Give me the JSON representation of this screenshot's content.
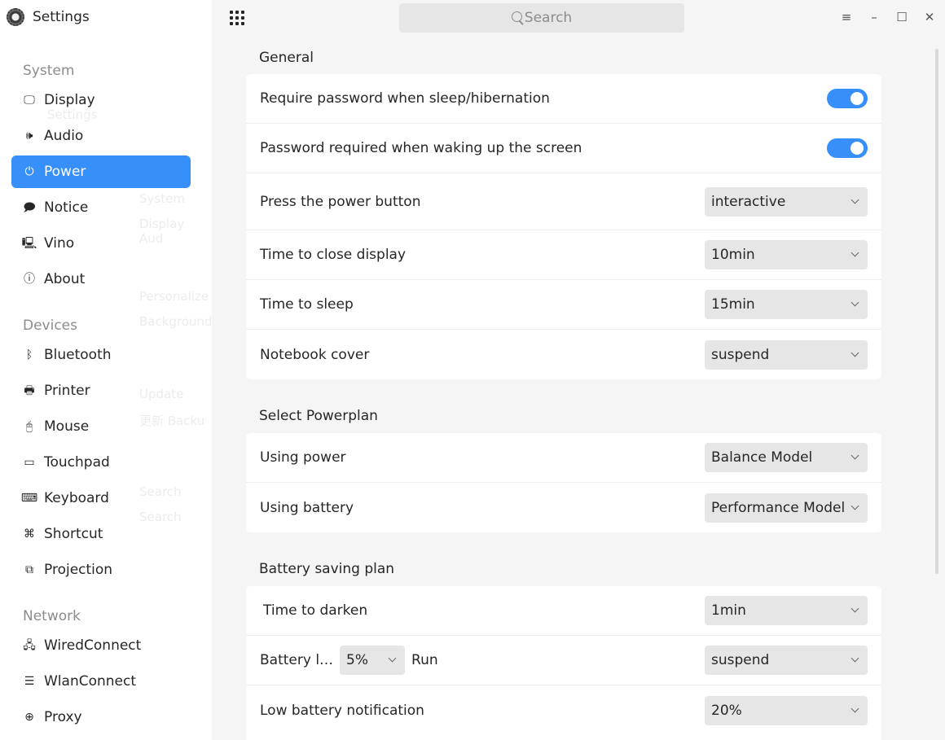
{
  "app": {
    "title": "Settings"
  },
  "search": {
    "placeholder": "Search"
  },
  "sidebar": {
    "groups": [
      {
        "label": "System"
      },
      {
        "label": "Devices"
      },
      {
        "label": "Network"
      }
    ],
    "items": [
      {
        "label": "Display",
        "icon": "display-icon"
      },
      {
        "label": "Audio",
        "icon": "audio-icon"
      },
      {
        "label": "Power",
        "icon": "power-icon",
        "active": true
      },
      {
        "label": "Notice",
        "icon": "notice-icon"
      },
      {
        "label": "Vino",
        "icon": "vino-icon"
      },
      {
        "label": "About",
        "icon": "about-icon"
      },
      {
        "label": "Bluetooth",
        "icon": "bluetooth-icon"
      },
      {
        "label": "Printer",
        "icon": "printer-icon"
      },
      {
        "label": "Mouse",
        "icon": "mouse-icon"
      },
      {
        "label": "Touchpad",
        "icon": "touchpad-icon"
      },
      {
        "label": "Keyboard",
        "icon": "keyboard-icon"
      },
      {
        "label": "Shortcut",
        "icon": "shortcut-icon"
      },
      {
        "label": "Projection",
        "icon": "projection-icon"
      },
      {
        "label": "WiredConnect",
        "icon": "wired-icon"
      },
      {
        "label": "WlanConnect",
        "icon": "wifi-icon"
      },
      {
        "label": "Proxy",
        "icon": "proxy-icon"
      }
    ]
  },
  "ghost": {
    "settings": "Settings",
    "system": "System",
    "system_sub": "Display  Aud",
    "personalized": "Personalize",
    "personalized_sub": "Background",
    "update": "Update",
    "update_sub": "更新  Backu",
    "search": "Search",
    "search_sub": "Search"
  },
  "general": {
    "title": "General",
    "rows": [
      {
        "label": "Require password when sleep/hibernation",
        "toggle": true
      },
      {
        "label": "Password required when waking up the screen",
        "toggle": true
      },
      {
        "label": "Press the power button",
        "value": "interactive"
      },
      {
        "label": "Time to close display",
        "value": "10min"
      },
      {
        "label": "Time to sleep",
        "value": "15min"
      },
      {
        "label": "Notebook cover",
        "value": "suspend"
      }
    ]
  },
  "powerplan": {
    "title": "Select Powerplan",
    "rows": [
      {
        "label": "Using power",
        "value": "Balance Model"
      },
      {
        "label": "Using battery",
        "value": "Performance Model"
      }
    ]
  },
  "battery": {
    "title": "Battery saving plan",
    "rows": [
      {
        "label": "Time to darken",
        "value": "1min"
      },
      {
        "label": "Battery l…",
        "level": "5%",
        "run_label": "Run",
        "value": "suspend"
      },
      {
        "label": "Low battery notification",
        "value": "20%"
      }
    ]
  }
}
